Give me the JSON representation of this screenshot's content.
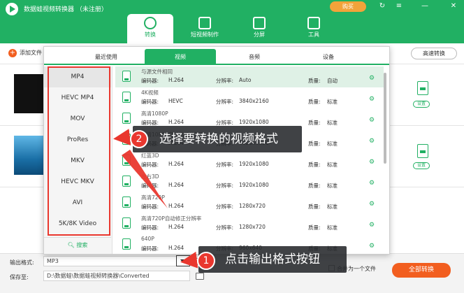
{
  "app": {
    "title": "数据蛙视频转换器 （未注册）",
    "buy_label": "购买",
    "window_icons": [
      "↻",
      "≡",
      "—",
      "✕"
    ]
  },
  "nav_tabs": [
    {
      "label": "转换",
      "active": true
    },
    {
      "label": "短视频制作",
      "active": false
    },
    {
      "label": "分屏",
      "active": false
    },
    {
      "label": "工具",
      "active": false
    }
  ],
  "toolbar": {
    "add_label": "添加文件",
    "speed_label": "高速转换"
  },
  "file_rows": [
    {
      "settings_label": "设置"
    },
    {
      "settings_label": "设置"
    }
  ],
  "popup": {
    "tabs": [
      {
        "label": "最近使用",
        "active": false
      },
      {
        "label": "视频",
        "active": true
      },
      {
        "label": "音频",
        "active": false
      },
      {
        "label": "设备",
        "active": false
      }
    ],
    "formats": [
      "MP4",
      "HEVC MP4",
      "MOV",
      "ProRes",
      "MKV",
      "HEVC MKV",
      "AVI",
      "5K/8K Video"
    ],
    "search_label": "搜索",
    "field_labels": {
      "encoder": "编码器:",
      "resolution": "分辨率:",
      "quality": "质量:"
    },
    "presets": [
      {
        "title": "与源文件相同",
        "encoder": "H.264",
        "resolution": "Auto",
        "quality": "自动"
      },
      {
        "title": "4K视频",
        "encoder": "HEVC",
        "resolution": "3840x2160",
        "quality": "标准"
      },
      {
        "title": "高清1080P",
        "encoder": "H.264",
        "resolution": "1920x1080",
        "quality": "标准"
      },
      {
        "title": "高清1080P自动修正分辨率",
        "encoder": "H.264",
        "resolution": "1920x1080",
        "quality": "标准"
      },
      {
        "title": "红蓝3D",
        "encoder": "H.264",
        "resolution": "1920x1080",
        "quality": "标准"
      },
      {
        "title": "左右3D",
        "encoder": "H.264",
        "resolution": "1920x1080",
        "quality": "标准"
      },
      {
        "title": "高清720P",
        "encoder": "H.264",
        "resolution": "1280x720",
        "quality": "标准"
      },
      {
        "title": "高清720P自动修正分辨率",
        "encoder": "H.264",
        "resolution": "1280x720",
        "quality": "标准"
      },
      {
        "title": "640P",
        "encoder": "H.264",
        "resolution": "960x640",
        "quality": "标准"
      }
    ]
  },
  "bottom": {
    "output_format_label": "输出格式:",
    "output_format_value": "MP3",
    "save_to_label": "保存至:",
    "save_to_value": "D:\\数据蛙\\数据蛙视频转换器\\Converted",
    "merge_label": "合并为一个文件",
    "convert_all_label": "全部转换"
  },
  "callouts": [
    {
      "number": "2",
      "text": "选择要转换的视频格式"
    },
    {
      "number": "1",
      "text": "点击输出格式按钮"
    }
  ],
  "colors": {
    "brand_green": "#21b063",
    "accent_orange": "#f25e1f",
    "highlight_red": "#e9372e",
    "buy_orange": "#f2a33a"
  }
}
